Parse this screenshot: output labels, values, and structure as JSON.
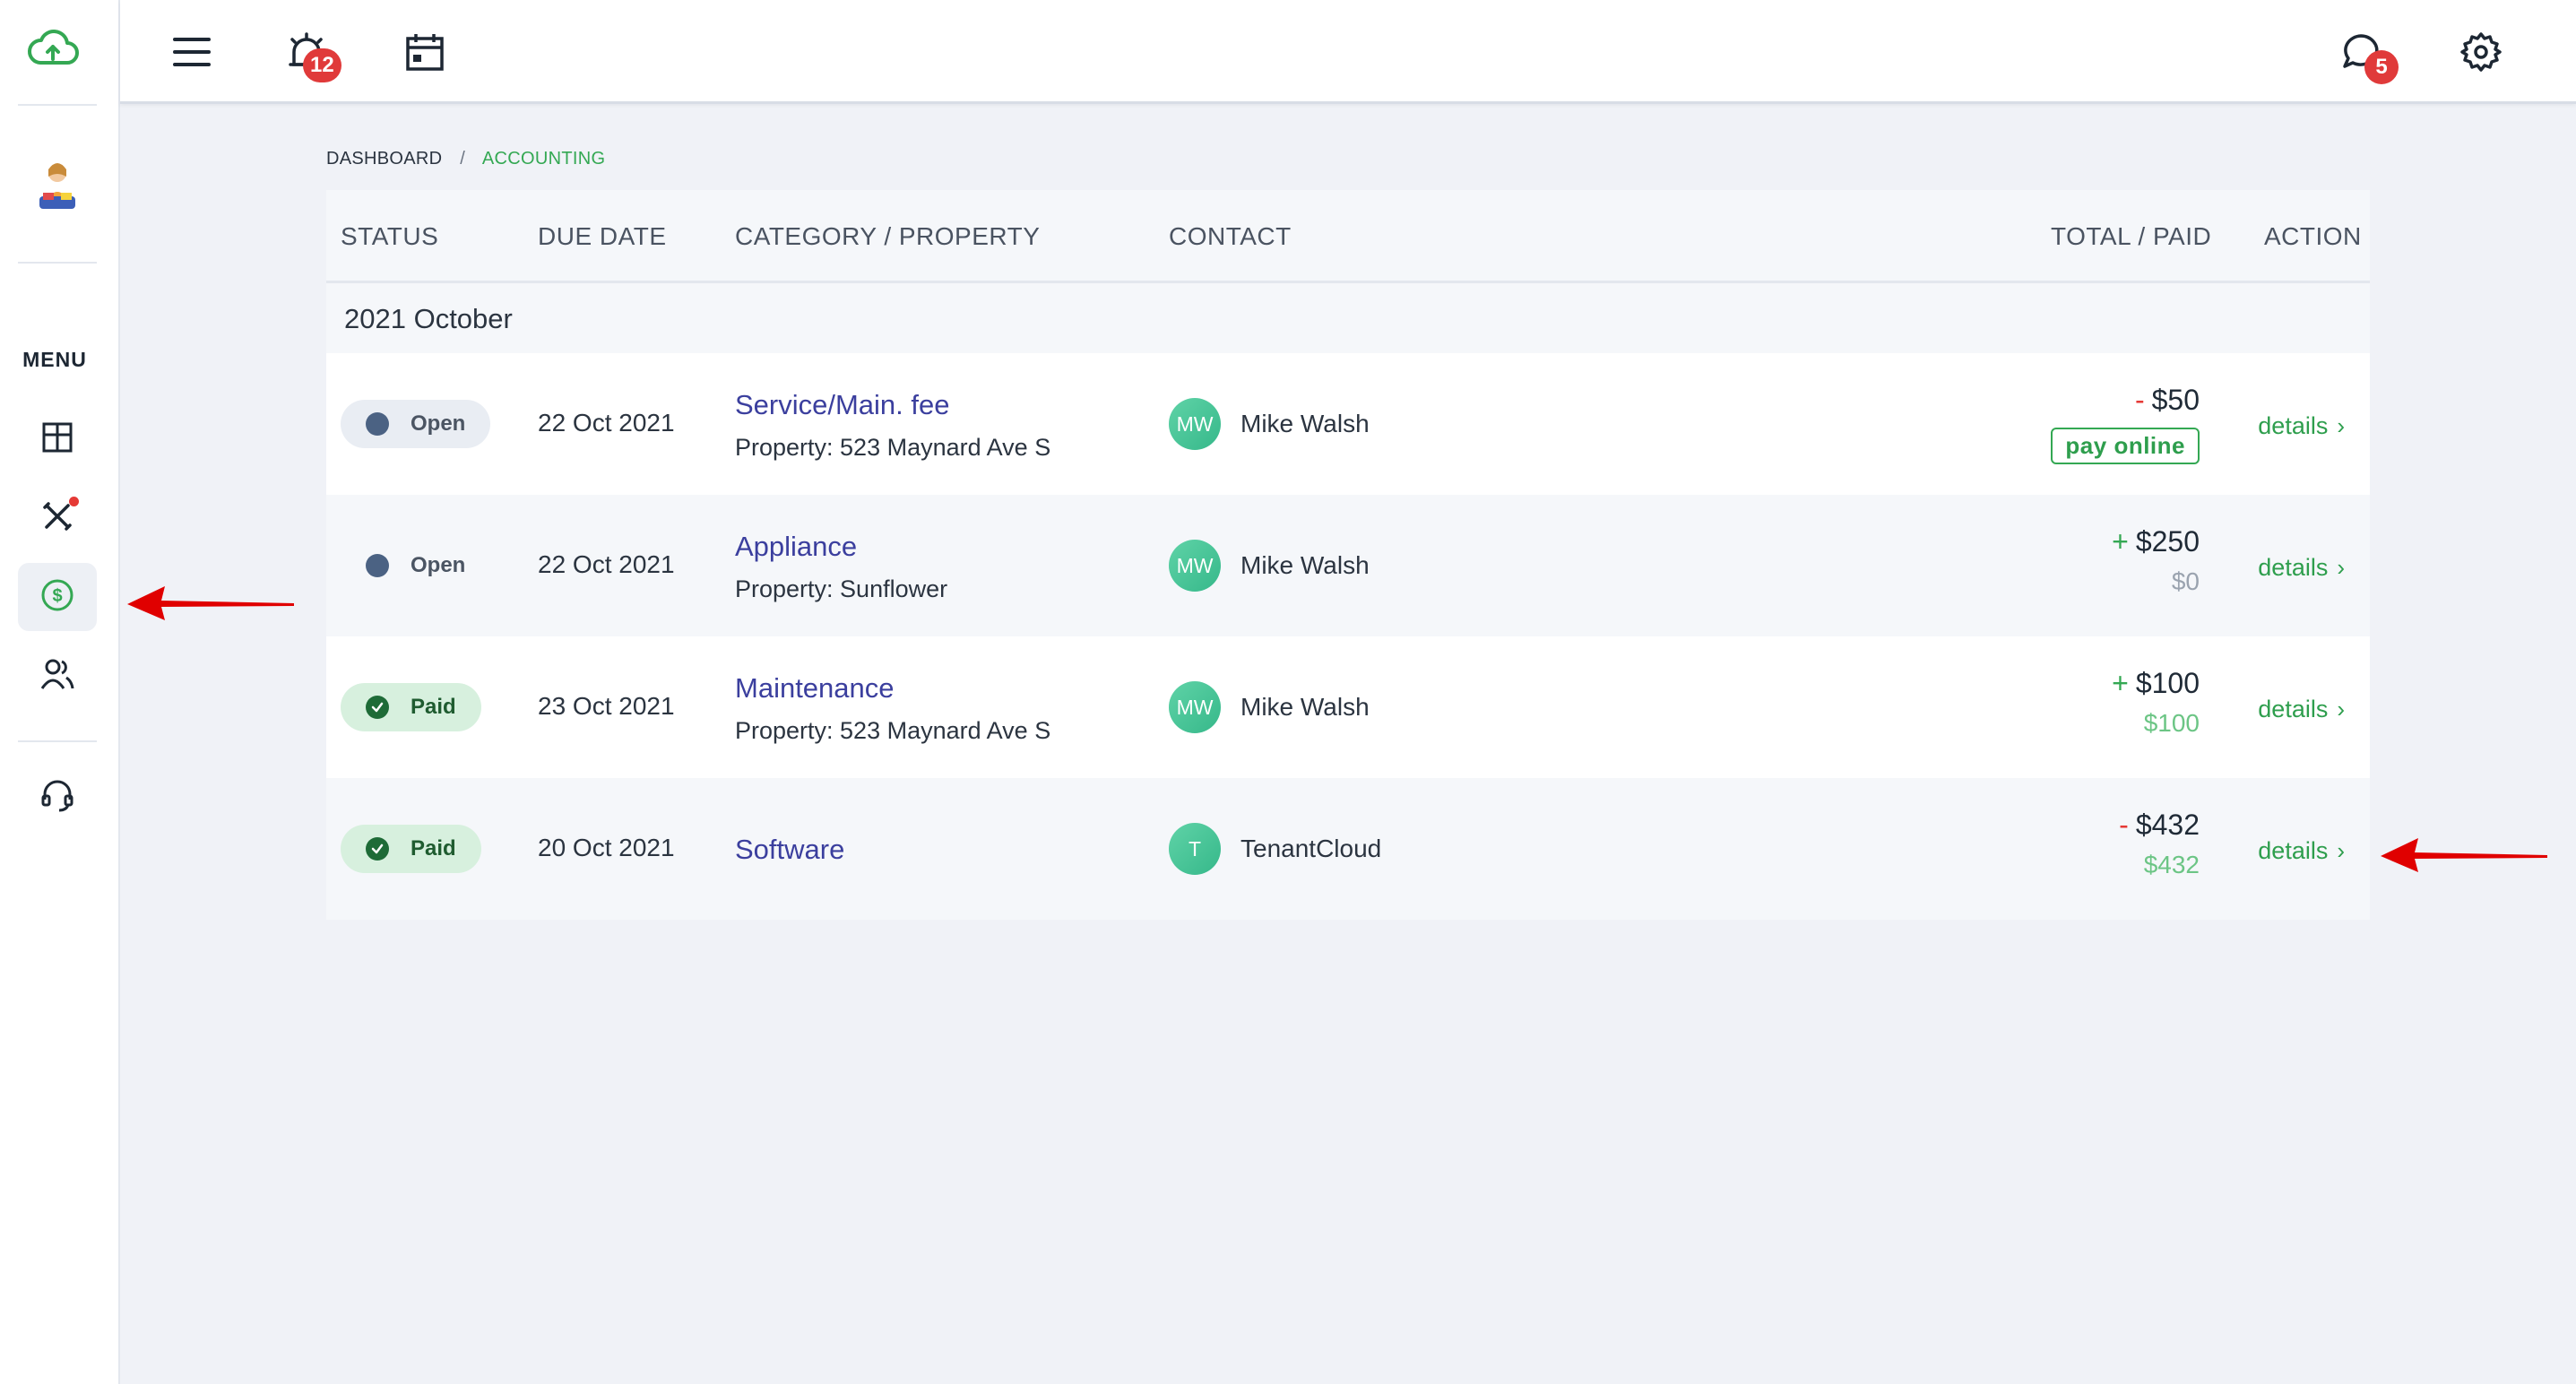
{
  "sidebar": {
    "menu_label": "MENU",
    "items": [
      {
        "name": "dashboard",
        "icon": "dashboard-grid-icon"
      },
      {
        "name": "maintenance",
        "icon": "tools-icon",
        "has_dot": true
      },
      {
        "name": "accounting",
        "icon": "dollar-circle-icon",
        "active": true
      },
      {
        "name": "contacts",
        "icon": "users-icon"
      },
      {
        "name": "support",
        "icon": "headset-icon"
      }
    ]
  },
  "topbar": {
    "alarm_badge": "12",
    "messages_badge": "5"
  },
  "breadcrumb": {
    "root": "DASHBOARD",
    "separator": "/",
    "current": "ACCOUNTING"
  },
  "table": {
    "headers": {
      "status": "STATUS",
      "due_date": "DUE DATE",
      "category": "CATEGORY / PROPERTY",
      "contact": "CONTACT",
      "total": "TOTAL / PAID",
      "action": "ACTION"
    },
    "group_label": "2021 October",
    "rows": [
      {
        "status": "Open",
        "due_date": "22 Oct 2021",
        "category": "Service/Main. fee",
        "property": "Property: 523 Maynard Ave S",
        "contact_initials": "MW",
        "contact_name": "Mike Walsh",
        "sign": "-",
        "total": "$50",
        "action_button": "pay online",
        "details": "details"
      },
      {
        "status": "Open",
        "due_date": "22 Oct 2021",
        "category": "Appliance",
        "property": "Property: Sunflower",
        "contact_initials": "MW",
        "contact_name": "Mike Walsh",
        "sign": "+",
        "total": "$250",
        "paid": "$0",
        "details": "details"
      },
      {
        "status": "Paid",
        "due_date": "23 Oct 2021",
        "category": "Maintenance",
        "property": "Property: 523 Maynard Ave S",
        "contact_initials": "MW",
        "contact_name": "Mike Walsh",
        "sign": "+",
        "total": "$100",
        "paid": "$100",
        "details": "details"
      },
      {
        "status": "Paid",
        "due_date": "20 Oct 2021",
        "category": "Software",
        "contact_initials": "T",
        "contact_name": "TenantCloud",
        "sign": "-",
        "total": "$432",
        "paid": "$432",
        "details": "details"
      }
    ]
  },
  "colors": {
    "accent_green": "#34a853",
    "link_purple": "#3b3f9e",
    "annotation_red": "#e00000"
  }
}
